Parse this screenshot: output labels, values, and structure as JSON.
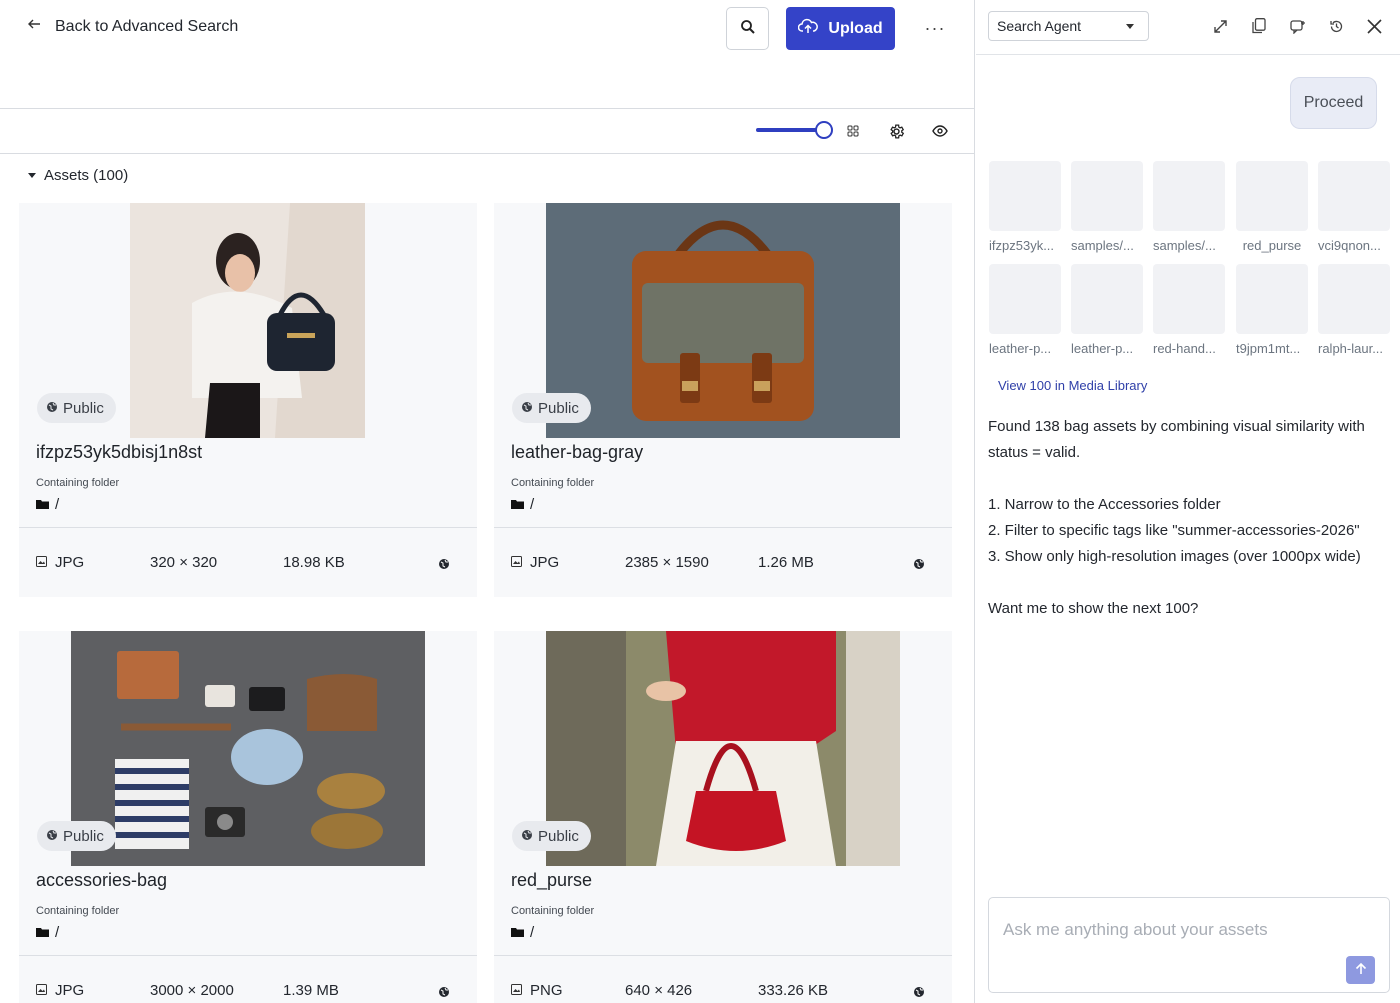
{
  "header": {
    "back_label": "Back to Advanced Search",
    "upload_label": "Upload",
    "more_label": "···"
  },
  "assets_section": {
    "title": "Assets (100)"
  },
  "assets": [
    {
      "name": "ifzpz53yk5dbisj1n8st",
      "badge": "Public",
      "folder_label": "Containing folder",
      "folder_path": "/",
      "type": "JPG",
      "dims": "320 × 320",
      "size": "18.98 KB"
    },
    {
      "name": "leather-bag-gray",
      "badge": "Public",
      "folder_label": "Containing folder",
      "folder_path": "/",
      "type": "JPG",
      "dims": "2385 × 1590",
      "size": "1.26 MB"
    },
    {
      "name": "accessories-bag",
      "badge": "Public",
      "folder_label": "Containing folder",
      "folder_path": "/",
      "type": "JPG",
      "dims": "3000 × 2000",
      "size": "1.39 MB"
    },
    {
      "name": "red_purse",
      "badge": "Public",
      "folder_label": "Containing folder",
      "folder_path": "/",
      "type": "PNG",
      "dims": "640 × 426",
      "size": "333.26 KB"
    }
  ],
  "agent_panel": {
    "agent_select": "Search Agent",
    "proceed_label": "Proceed",
    "thumbnails": [
      "ifzpz53yk...",
      "samples/...",
      "samples/...",
      "red_purse",
      "vci9qnon...",
      "leather-p...",
      "leather-p...",
      "red-hand...",
      "t9jpm1mt...",
      "ralph-laur..."
    ],
    "view_library_link": "View 100 in Media Library",
    "message": {
      "intro": "Found 138 bag assets by combining visual similarity with status = valid.",
      "options": [
        "1. Narrow to the Accessories folder",
        "2. Filter to specific tags like \"summer-accessories-2026\"",
        "3. Show only high-resolution images (over 1000px wide)"
      ],
      "question": "Want me to show the next 100?"
    },
    "chat_placeholder": "Ask me anything about your assets"
  },
  "theme": {
    "accent": "#3443c8",
    "send_button": "#8e99e0"
  },
  "icons": [
    "arrow-left-icon",
    "search-icon",
    "cloud-upload-icon",
    "more-icon",
    "grid-icon",
    "gear-icon",
    "eye-icon",
    "globe-icon",
    "folder-icon",
    "image-file-icon",
    "expand-icon",
    "copy-icon",
    "new-chat-icon",
    "history-icon",
    "close-icon",
    "arrow-up-icon"
  ]
}
